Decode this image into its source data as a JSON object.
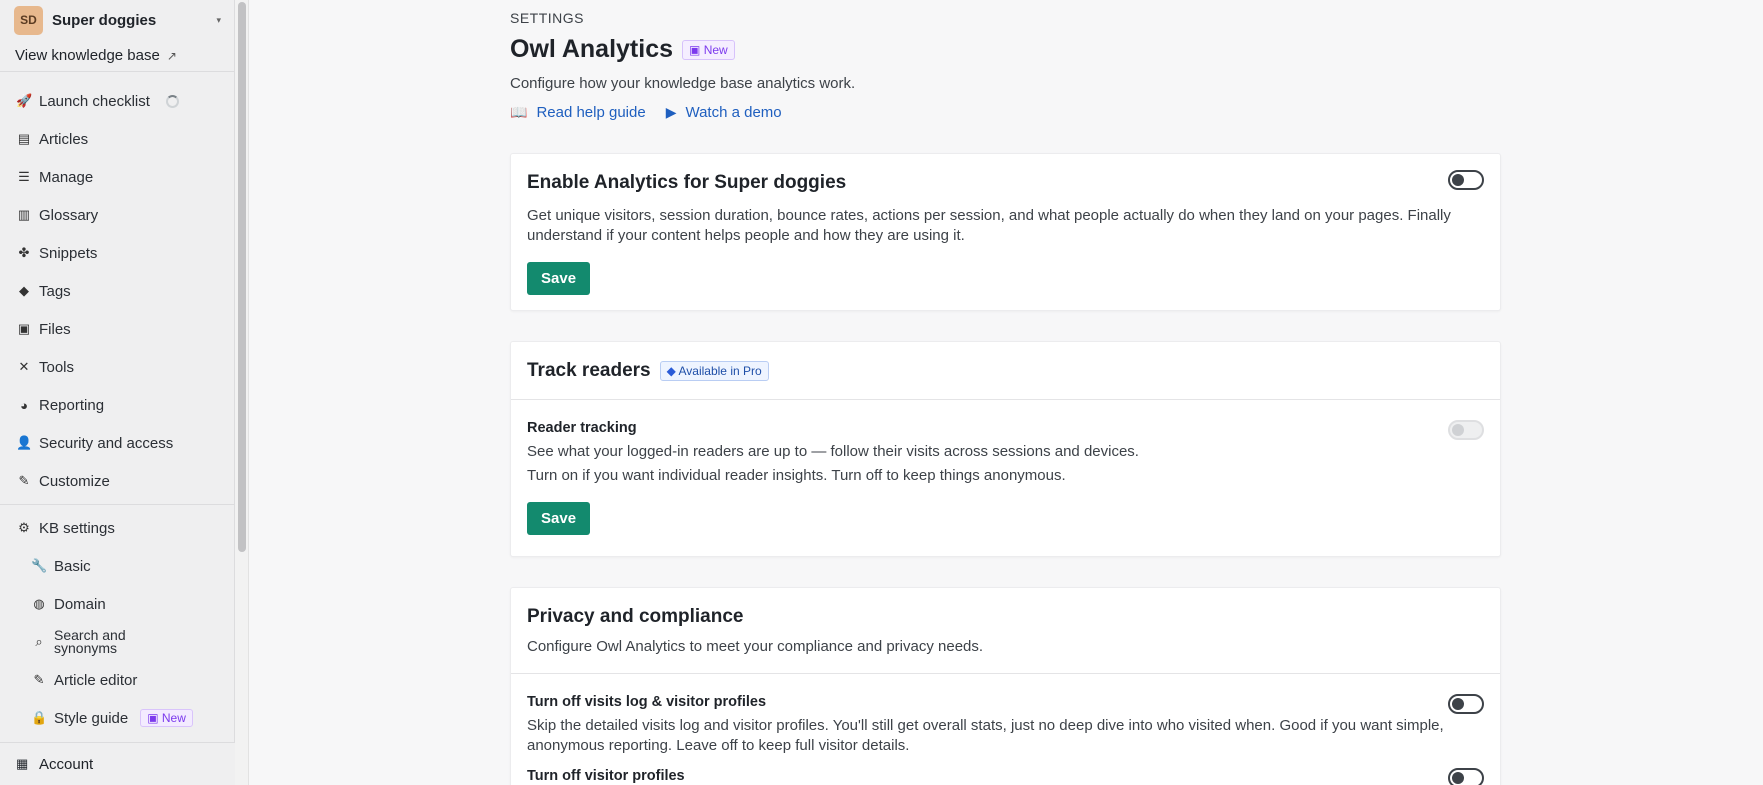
{
  "sidebar": {
    "workspace": {
      "initials": "SD",
      "name": "Super doggies"
    },
    "kb_link": "View knowledge base",
    "items": [
      {
        "label": "Launch checklist",
        "icon": "rocket-icon"
      },
      {
        "label": "Articles",
        "icon": "document-icon"
      },
      {
        "label": "Manage",
        "icon": "list-icon"
      },
      {
        "label": "Glossary",
        "icon": "book-icon"
      },
      {
        "label": "Snippets",
        "icon": "puzzle-icon"
      },
      {
        "label": "Tags",
        "icon": "tag-icon"
      },
      {
        "label": "Files",
        "icon": "image-icon"
      },
      {
        "label": "Tools",
        "icon": "tools-icon"
      },
      {
        "label": "Reporting",
        "icon": "chart-pie-icon"
      },
      {
        "label": "Security and access",
        "icon": "users-lock-icon"
      },
      {
        "label": "Customize",
        "icon": "brush-icon"
      }
    ],
    "kb_settings": {
      "label": "KB settings",
      "items": [
        {
          "label": "Basic",
          "icon": "wrench-icon"
        },
        {
          "label": "Domain",
          "icon": "globe-icon"
        },
        {
          "label": "Search and synonyms",
          "icon": "search-icon"
        },
        {
          "label": "Article editor",
          "icon": "pen-icon"
        },
        {
          "label": "Style guide",
          "icon": "lock-icon",
          "badge": "New"
        }
      ]
    },
    "account": "Account"
  },
  "page": {
    "eyebrow": "SETTINGS",
    "title": "Owl Analytics",
    "title_badge": "New",
    "subtitle": "Configure how your knowledge base analytics work.",
    "help_link": "Read help guide",
    "demo_link": "Watch a demo"
  },
  "enable_card": {
    "title": "Enable Analytics for Super doggies",
    "text": "Get unique visitors, session duration, bounce rates, actions per session, and what people actually do when they land on your pages. Finally understand if your content helps people and how they are using it.",
    "toggle_on": false,
    "save": "Save"
  },
  "track_card": {
    "title": "Track readers",
    "badge": "Available in Pro",
    "row_title": "Reader tracking",
    "line1": "See what your logged-in readers are up to — follow their visits across sessions and devices.",
    "line2": "Turn on if you want individual reader insights. Turn off to keep things anonymous.",
    "toggle_on": false,
    "save": "Save"
  },
  "privacy_card": {
    "title": "Privacy and compliance",
    "subtitle": "Configure Owl Analytics to meet your compliance and privacy needs.",
    "row1_title": "Turn off visits log & visitor profiles",
    "row1_text": "Skip the detailed visits log and visitor profiles. You'll still get overall stats, just no deep dive into who visited when. Good if you want simple, anonymous reporting. Leave off to keep full visitor details.",
    "row2_title": "Turn off visitor profiles"
  },
  "colors": {
    "accent": "#138a6e",
    "link": "#1f5fbf",
    "new_badge": "#7c3aed"
  }
}
